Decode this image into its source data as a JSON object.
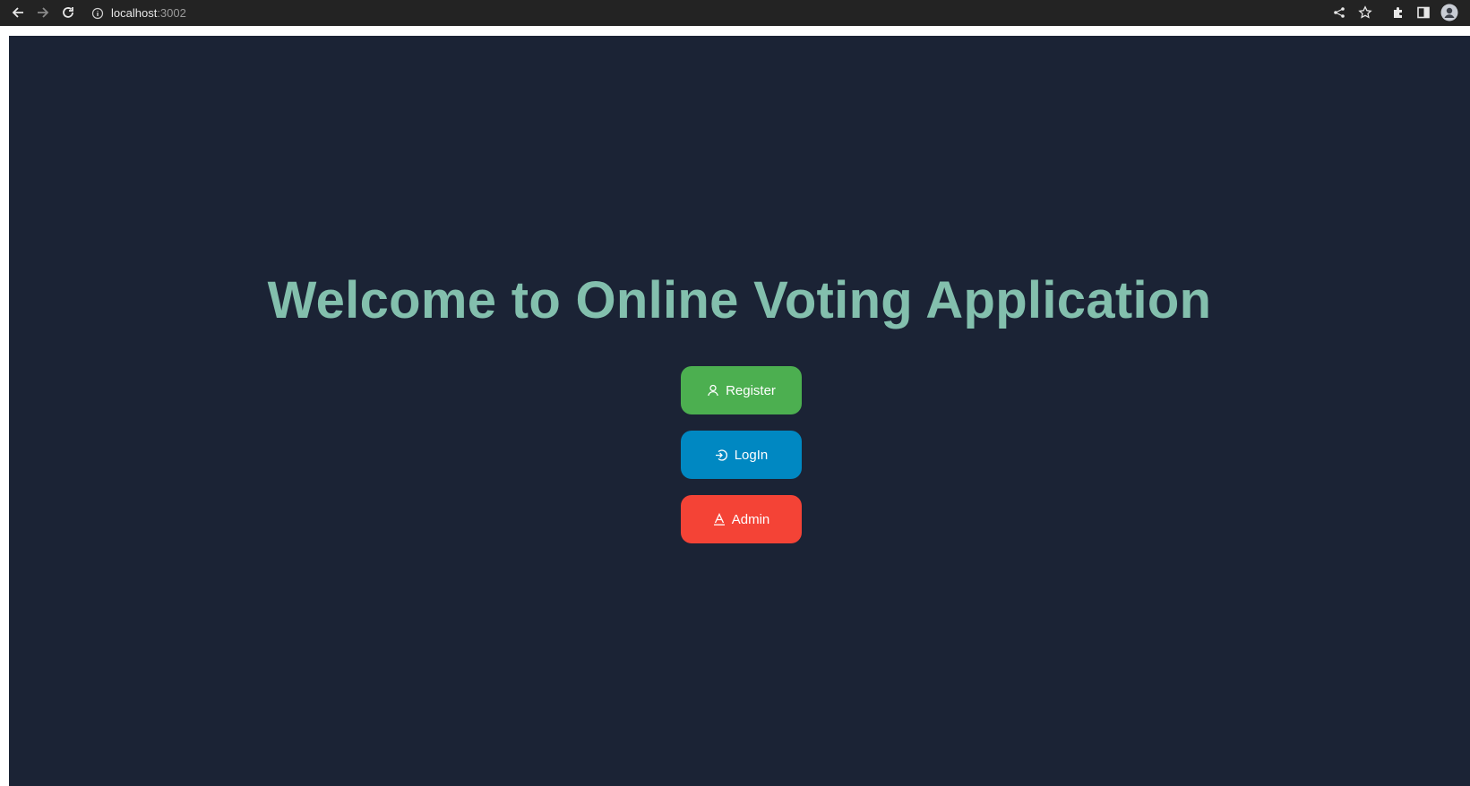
{
  "browser": {
    "url_host": "localhost",
    "url_port": ":3002",
    "icons": [
      "back-arrow-icon",
      "forward-arrow-icon",
      "reload-icon",
      "info-icon",
      "share-icon",
      "star-icon",
      "extensions-icon",
      "side-panel-icon",
      "profile-icon"
    ]
  },
  "page": {
    "title": "Welcome to Online Voting Application",
    "background_color": "#1b2335",
    "title_color": "#83bfad"
  },
  "buttons": {
    "register": {
      "label": "Register",
      "icon": "user-icon",
      "color": "#4caf50"
    },
    "login": {
      "label": "LogIn",
      "icon": "login-icon",
      "color": "#0088c2"
    },
    "admin": {
      "label": "Admin",
      "icon": "admin-icon",
      "color": "#f44336"
    }
  }
}
